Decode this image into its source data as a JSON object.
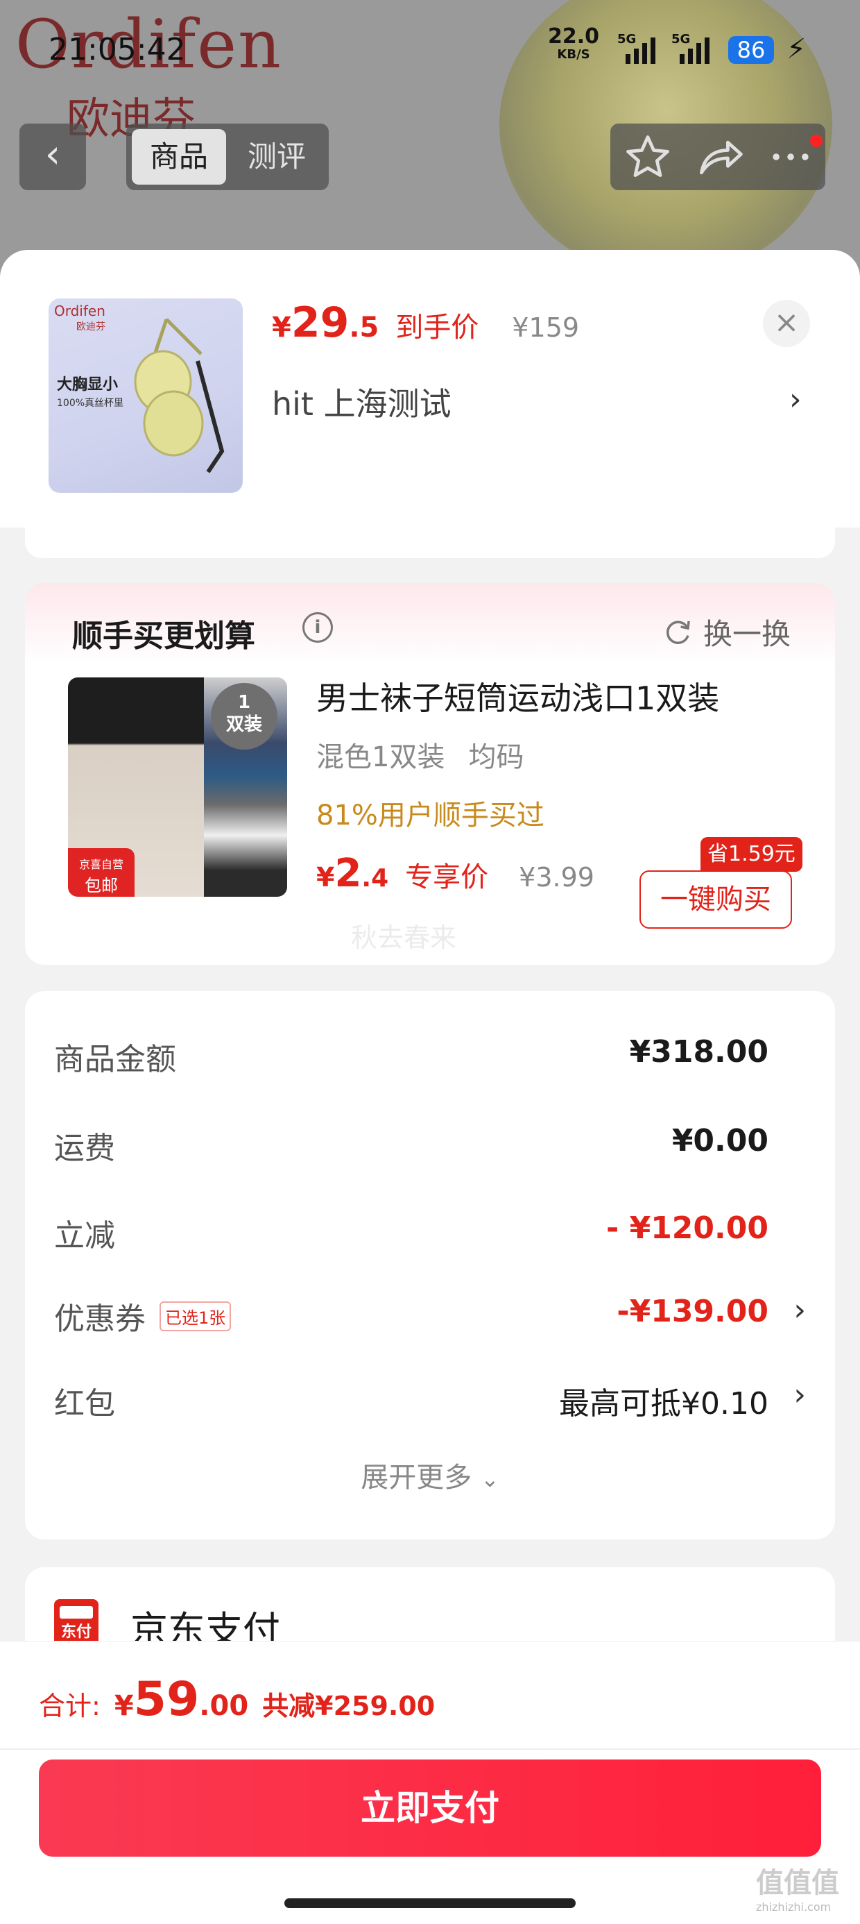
{
  "status_bar": {
    "time": "21:05:42",
    "net_speed": "22.0",
    "net_unit": "KB/S",
    "sim1": "5G",
    "sim2": "5G",
    "battery": "86"
  },
  "background": {
    "brand_en": "Ordifen",
    "brand_cn": "欧迪芬",
    "tabs": [
      "商品",
      "测评"
    ]
  },
  "product": {
    "yen": "¥",
    "price_int": "29",
    "price_dec": ".5",
    "price_tag": "到手价",
    "original_price": "¥159",
    "address": "hit  上海测试",
    "thumb_brand": "Ordifen",
    "thumb_brand_cn": "欧迪芬",
    "thumb_line1": "大胸显小",
    "thumb_line2": "100%真丝杯里"
  },
  "addon": {
    "title": "顺手买更划算",
    "refresh_label": "换一换",
    "name": "男士袜子短筒运动浅口1双装",
    "spec": [
      "混色1双装",
      "均码"
    ],
    "social": "81%用户顺手买过",
    "yen": "¥",
    "price_int": "2",
    "price_dec": ".4",
    "price_tag": "专享价",
    "original_price": "¥3.99",
    "buy_label": "一键购买",
    "save_badge": "省1.59元",
    "img_pack_num": "1",
    "img_pack_text": "双装",
    "img_badge_1": "京喜自营",
    "img_badge_2": "包邮",
    "watermark": "秋去春来"
  },
  "summary": {
    "rows": [
      {
        "label": "商品金额",
        "value": "¥318.00"
      },
      {
        "label": "运费",
        "value": "¥0.00"
      },
      {
        "label": "立减",
        "value": "- ¥120.00"
      },
      {
        "label": "优惠券",
        "tag": "已选1张",
        "value": "-¥139.00"
      },
      {
        "label": "红包",
        "value": "最高可抵¥0.10"
      }
    ],
    "expand_label": "展开更多"
  },
  "payment": {
    "method": "京东支付",
    "logo_text": "东付"
  },
  "bottom": {
    "total_label": "合计:",
    "yen": "¥",
    "total_int": "59",
    "total_dec": ".00",
    "saved": "共减¥259.00",
    "pay_label": "立即支付"
  },
  "corner_mark": "值值值",
  "corner_sub": "zhizhizhi.com",
  "colors": {
    "accent": "#e2231a",
    "pay_button": "#ff1f3a",
    "social_proof": "#c98a1d"
  }
}
